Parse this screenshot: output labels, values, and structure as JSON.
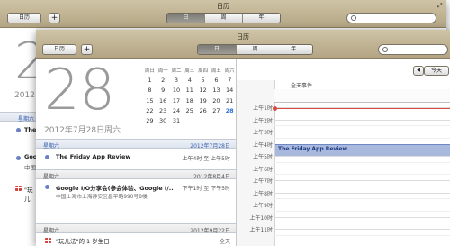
{
  "back_window": {
    "title": "日历",
    "calendar_button": "日历",
    "add_button": "+",
    "view_tabs": [
      "日",
      "周",
      "年"
    ],
    "big_date_partial": "2",
    "year_partial": "2012",
    "section_label": "星期六",
    "event_prefix_1": "The",
    "event_prefix_2": "Goo",
    "event_prefix_2b": "中国",
    "event_prefix_3": "\"玩儿"
  },
  "front_window": {
    "title": "日历",
    "calendar_button": "日历",
    "add_button": "+",
    "view_tabs": [
      {
        "label": "日",
        "selected": true
      },
      {
        "label": "周",
        "selected": false
      },
      {
        "label": "年",
        "selected": false
      }
    ],
    "search_placeholder": "",
    "day_header": {
      "big_day": "28",
      "full_date": "2012年7月28日周六"
    },
    "mini_calendar": {
      "weekdays": [
        "周日",
        "周一",
        "周二",
        "周三",
        "周四",
        "周五",
        "周六"
      ],
      "weeks": [
        [
          "1",
          "2",
          "3",
          "4",
          "5",
          "6",
          "7"
        ],
        [
          "8",
          "9",
          "10",
          "11",
          "12",
          "13",
          "14"
        ],
        [
          "15",
          "16",
          "17",
          "18",
          "19",
          "20",
          "21"
        ],
        [
          "22",
          "23",
          "24",
          "25",
          "26",
          "27",
          "28"
        ],
        [
          "29",
          "30",
          "31",
          "",
          "",
          "",
          ""
        ]
      ],
      "today": "28"
    },
    "sections": [
      {
        "day": "星期六",
        "date": "2012年7月28日",
        "events": [
          {
            "title": "The Friday App Review",
            "time": "上午4时 至 上午5时",
            "location": ""
          }
        ]
      },
      {
        "day": "星期六",
        "date": "2012年8月4日",
        "events": [
          {
            "title": "Google I/O分享会(参会体验、Google I/...",
            "time": "下午1时 至 下午5时",
            "location": "中国上海市上海静安区昌平路990号8楼"
          }
        ]
      },
      {
        "day": "星期六",
        "date": "2012年9月22日",
        "events": [
          {
            "title": "\"玩儿法\"的 1 岁生日",
            "time": "全天",
            "location": ""
          }
        ]
      }
    ],
    "day_view": {
      "today_button": "今天",
      "prev_arrow": "◀",
      "all_day_label": "全天事件",
      "hours": [
        "上午1时",
        "上午2时",
        "上午3时",
        "上午4时",
        "上午5时",
        "上午6时",
        "上午7时",
        "上午8时",
        "上午9时",
        "上午10时",
        "上午11时"
      ],
      "event_title": "The Friday App Review",
      "event_start_hour": 4,
      "event_end_hour": 5,
      "current_time_hour": 1.05
    },
    "colors": {
      "event_blue": "#a9b8dd",
      "today_blue": "#2f6fd8",
      "now_red": "#d84c40"
    }
  }
}
